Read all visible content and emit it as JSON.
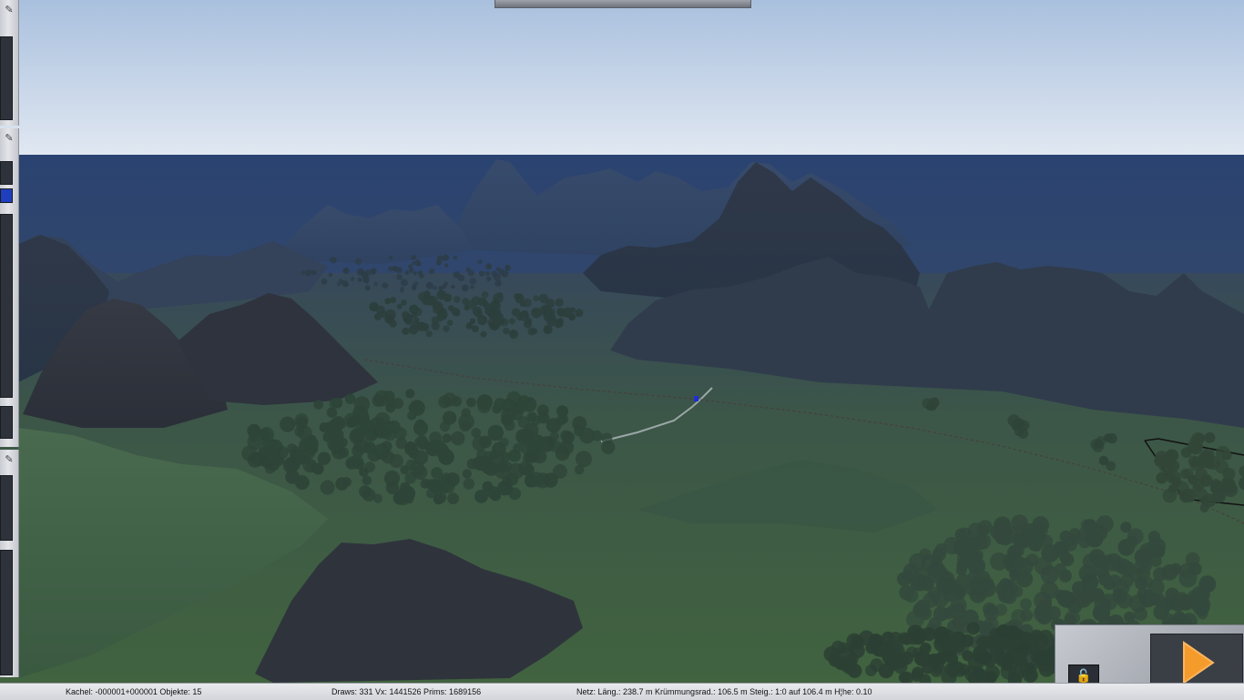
{
  "status": {
    "tile": "Kachel: -000001+000001  Objekte: 15",
    "draws": "Draws: 331 Vx: 1441526 Prims: 1689156",
    "net": "Netz:  Läng.:   238.7 m Krümmungsrad.: 106.5 m Steig.: 1:0 auf 106.4 m H¦he:   0.10"
  },
  "icons": {
    "pin": "pin-icon",
    "lock": "unlock-icon",
    "play": "play-icon"
  },
  "colors": {
    "sky_top": "#a9c0de",
    "sky_horizon": "#e2e9f2",
    "fog": "#2d4670",
    "grass": "#3c5a48",
    "mountain": "#2c3340",
    "play_accent": "#f59b2c"
  }
}
